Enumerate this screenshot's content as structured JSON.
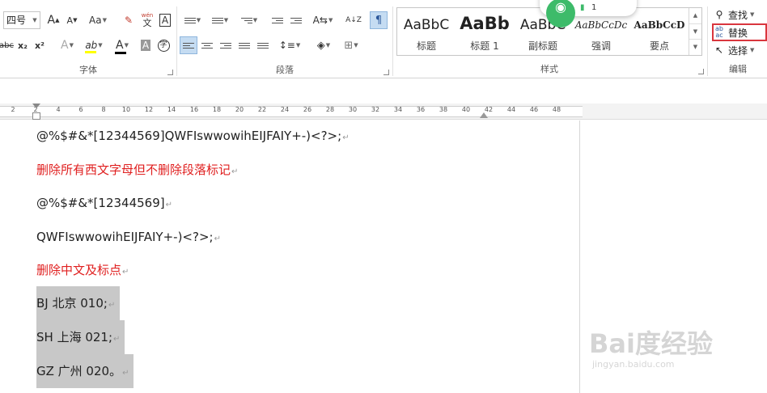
{
  "ribbon": {
    "font_group": {
      "label": "字体",
      "font_size": "四号",
      "grow_icon": "A",
      "shrink_icon": "A",
      "case_label": "Aa",
      "phonetic_label": "wén",
      "phonetic_char": "文",
      "border_char": "A",
      "strike_label": "abc",
      "sub_label": "x₂",
      "sup_label": "x²",
      "effects_label": "A",
      "highlight_label": "ab",
      "color_label": "A",
      "shading_label": "A",
      "enclose_label": "字",
      "highlight_color": "#ffff00",
      "font_color": "#000000"
    },
    "paragraph_group": {
      "label": "段落",
      "sort_label": "A↓Z"
    },
    "styles_group": {
      "label": "样式",
      "styles": [
        {
          "sample": "AaBbC",
          "name": "标题"
        },
        {
          "sample": "AaBb",
          "name": "标题 1"
        },
        {
          "sample": "AaBbC",
          "name": "副标题"
        },
        {
          "sample": "AaBbCcDc",
          "name": "强调"
        },
        {
          "sample": "AaBbCcD",
          "name": "要点"
        }
      ]
    },
    "editing_group": {
      "label": "编辑",
      "find": "查找",
      "replace": "替换",
      "select": "选择"
    }
  },
  "notification": {
    "count": "1",
    "accent": "#3dbb6a"
  },
  "ruler": {
    "ticks": [
      "2",
      "2",
      "4",
      "6",
      "8",
      "10",
      "12",
      "14",
      "16",
      "18",
      "20",
      "22",
      "24",
      "26",
      "28",
      "30",
      "32",
      "34",
      "36",
      "38",
      "40",
      "42",
      "44",
      "46",
      "48"
    ]
  },
  "document": {
    "lines": [
      {
        "text": "@%$#&*[12344569]QWFIswwowihEIJFAIY+-)<?>;",
        "style": "normal"
      },
      {
        "text": "删除所有西文字母但不删除段落标记",
        "style": "red"
      },
      {
        "text": "@%$#&*[12344569]",
        "style": "normal"
      },
      {
        "text": "QWFIswwowihEIJFAIY+-)<?>;",
        "style": "normal"
      },
      {
        "text": "删除中文及标点",
        "style": "red"
      },
      {
        "text": "BJ 北京 010;",
        "style": "highlight"
      },
      {
        "text": "SH 上海 021;",
        "style": "highlight"
      },
      {
        "text": "GZ 广州 020。",
        "style": "highlight"
      }
    ],
    "paragraph_mark": "↵",
    "red_color": "#e02020",
    "highlight_color": "#c8c8c8"
  },
  "watermark": {
    "brand": "Bai度经验",
    "url": "jingyan.baidu.com"
  }
}
